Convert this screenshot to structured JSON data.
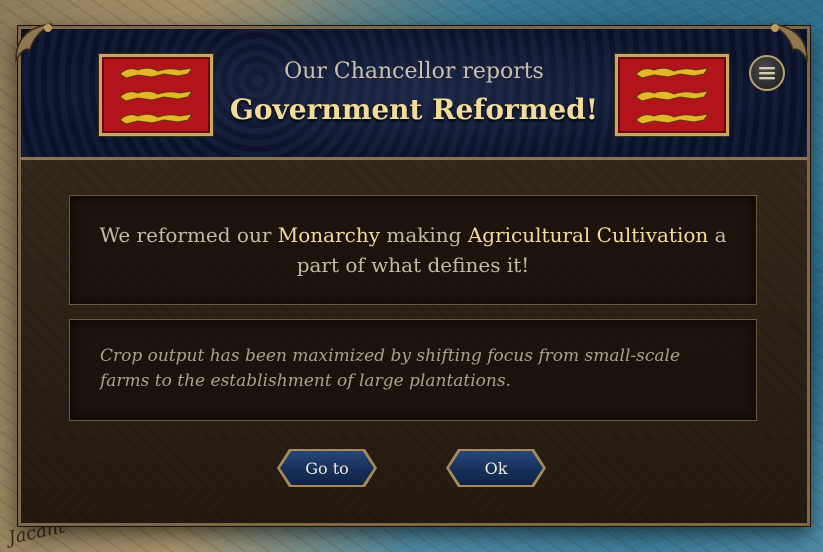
{
  "map": {
    "labels": [
      "Jacant"
    ]
  },
  "event": {
    "subtitle": "Our Chancellor reports",
    "title": "Government Reformed!",
    "main_parts": {
      "p1": "We reformed our ",
      "h1": "Monarchy",
      "p2": " making ",
      "h2": "Agricultural Cultivation",
      "p3": " a part of what defines it!"
    },
    "description": "Crop output has been maximized by shifting focus from small-scale farms to the establishment of large plantations."
  },
  "buttons": {
    "goto_label": "Go to",
    "ok_label": "Ok"
  },
  "icons": {
    "menu": "menu-icon",
    "banner": "coat-of-arms-icon"
  },
  "colors": {
    "highlight": "#f3dc9a",
    "banner_red": "#b3141b",
    "button_blue": "#1b3a68"
  }
}
